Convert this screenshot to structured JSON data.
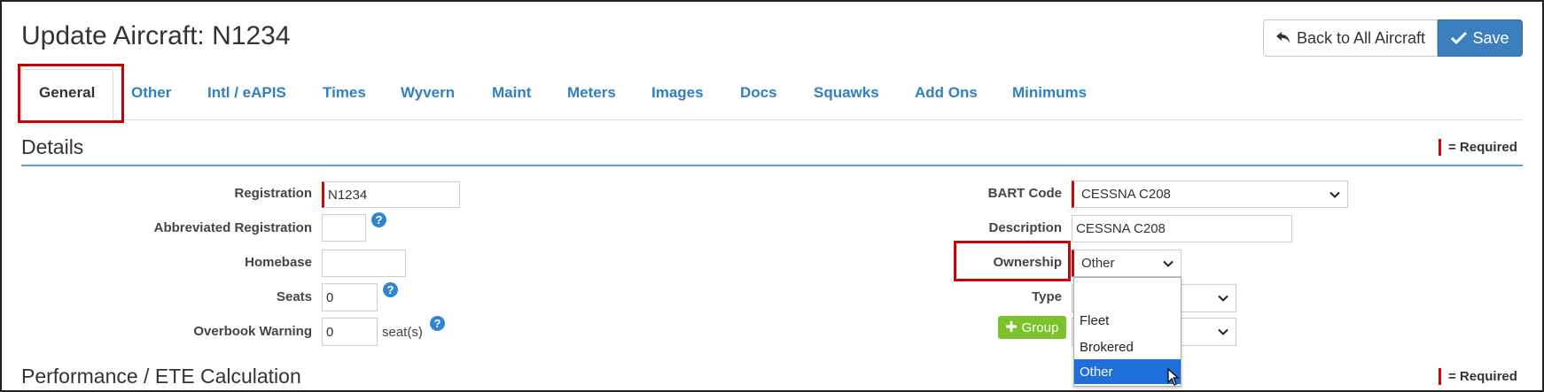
{
  "header": {
    "title": "Update Aircraft: N1234",
    "back_label": "Back to All Aircraft",
    "save_label": "Save"
  },
  "tabs": [
    {
      "label": "General",
      "active": true
    },
    {
      "label": "Other"
    },
    {
      "label": "Intl / eAPIS"
    },
    {
      "label": "Times"
    },
    {
      "label": "Wyvern"
    },
    {
      "label": "Maint"
    },
    {
      "label": "Meters"
    },
    {
      "label": "Images"
    },
    {
      "label": "Docs"
    },
    {
      "label": "Squawks"
    },
    {
      "label": "Add Ons"
    },
    {
      "label": "Minimums"
    }
  ],
  "details": {
    "title": "Details",
    "required_legend": "= Required",
    "registration": {
      "label": "Registration",
      "value": "N1234"
    },
    "abbreviated_registration": {
      "label": "Abbreviated Registration",
      "value": ""
    },
    "homebase": {
      "label": "Homebase",
      "value": ""
    },
    "seats": {
      "label": "Seats",
      "value": "0"
    },
    "overbook_warning": {
      "label": "Overbook Warning",
      "value": "0",
      "suffix": "seat(s)"
    },
    "bart_code": {
      "label": "BART Code",
      "value": "CESSNA C208"
    },
    "description": {
      "label": "Description",
      "value": "CESSNA C208"
    },
    "ownership": {
      "label": "Ownership",
      "value": "Other",
      "options": [
        "",
        "Fleet",
        "Brokered",
        "Other"
      ],
      "selected": "Other"
    },
    "type": {
      "label": "Type",
      "value": ""
    },
    "group_button": "Group",
    "group": {
      "value": ""
    }
  },
  "performance": {
    "title": "Performance / ETE Calculation",
    "required_legend": "= Required"
  },
  "colors": {
    "link": "#2f7fc3",
    "save_bg": "#3c7fbf",
    "required": "#dd0000",
    "highlight": "#cc0000",
    "group_btn": "#7cc22a",
    "dropdown_selected": "#1e6fd9"
  },
  "icons": {
    "back": "back-arrow-icon",
    "save": "check-icon",
    "help": "question-circle-icon",
    "add": "plus-icon",
    "select": "chevron-down-icon"
  }
}
